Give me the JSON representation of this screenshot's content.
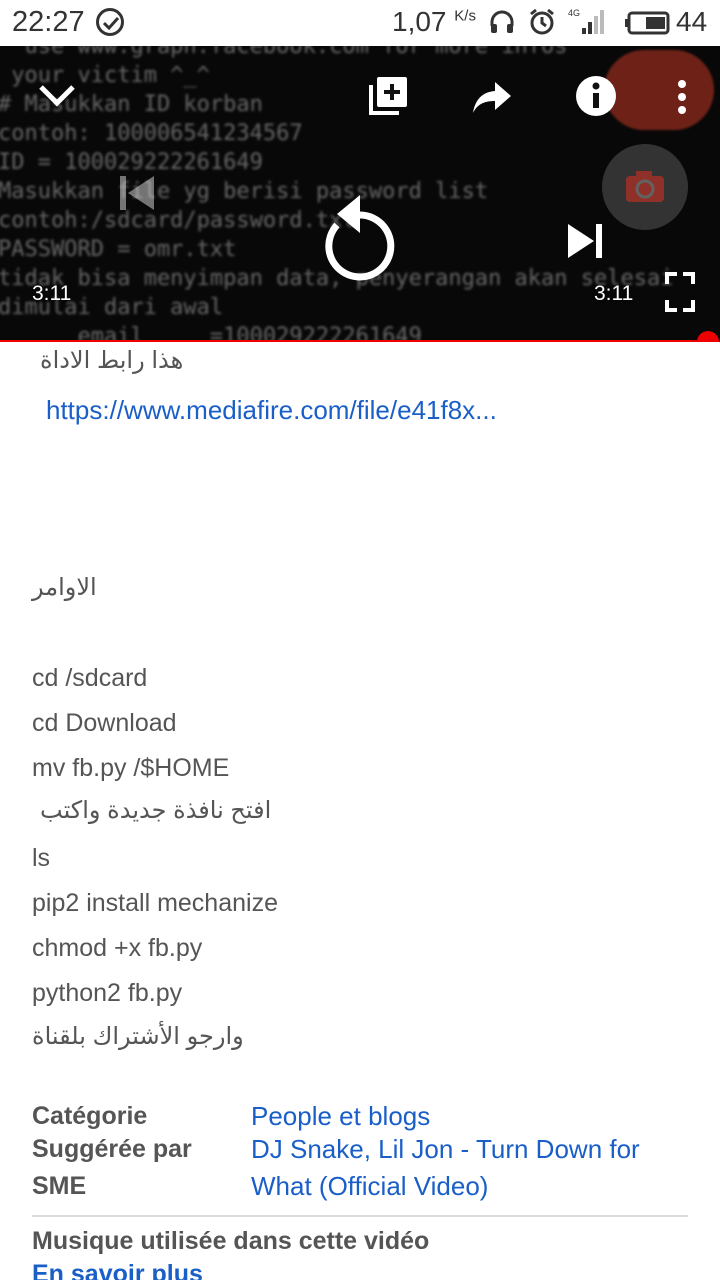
{
  "status_bar": {
    "time": "22:27",
    "net_speed": "1,07",
    "net_speed_unit": "K/s",
    "network_type": "4G",
    "battery": "44",
    "icons": [
      "check-circle-icon",
      "headphones-icon",
      "alarm-icon",
      "signal-icon",
      "battery-icon"
    ]
  },
  "player": {
    "terminal_lines": [
      "  use www.graph.facebook.com for more infos",
      " your victim ^_^",
      "# Masukkan ID korban",
      "contoh: 100006541234567",
      "ID = 100029222261649",
      "Masukkan file yg berisi password list",
      "contoh:/sdcard/password.txt",
      "PASSWORD = omr.txt",
      "tidak bisa menyimpan data, penyerangan akan selesai",
      "dimulai dari awal",
      "      email     =100029222261649"
    ],
    "current_time": "3:11",
    "duration": "3:11",
    "progress": 1.0,
    "accent_color": "#ee0000"
  },
  "description": {
    "tool_link_heading": "هذا رابط الاداة",
    "tool_link": "https://www.mediafire.com/file/e41f8x...",
    "commands_heading": "الاوامر",
    "commands": [
      "cd /sdcard",
      "cd Download",
      "mv fb.py /$HOME",
      "افتح نافذة جديدة واكتب",
      "ls",
      "pip2 install mechanize",
      "chmod +x fb.py",
      "python2 fb.py",
      "وارجو الأشتراك بلقناة"
    ]
  },
  "metadata": {
    "category_label": "Catégorie",
    "category_value": "People et blogs",
    "suggested_label_line1": "Suggérée par",
    "suggested_label_line2": "SME",
    "suggested_value_line1": "DJ Snake, Lil Jon - Turn Down for",
    "suggested_value_line2": "What (Official Video)",
    "music_heading": "Musique utilisée dans cette vidéo",
    "learn_more": "En savoir plus"
  }
}
